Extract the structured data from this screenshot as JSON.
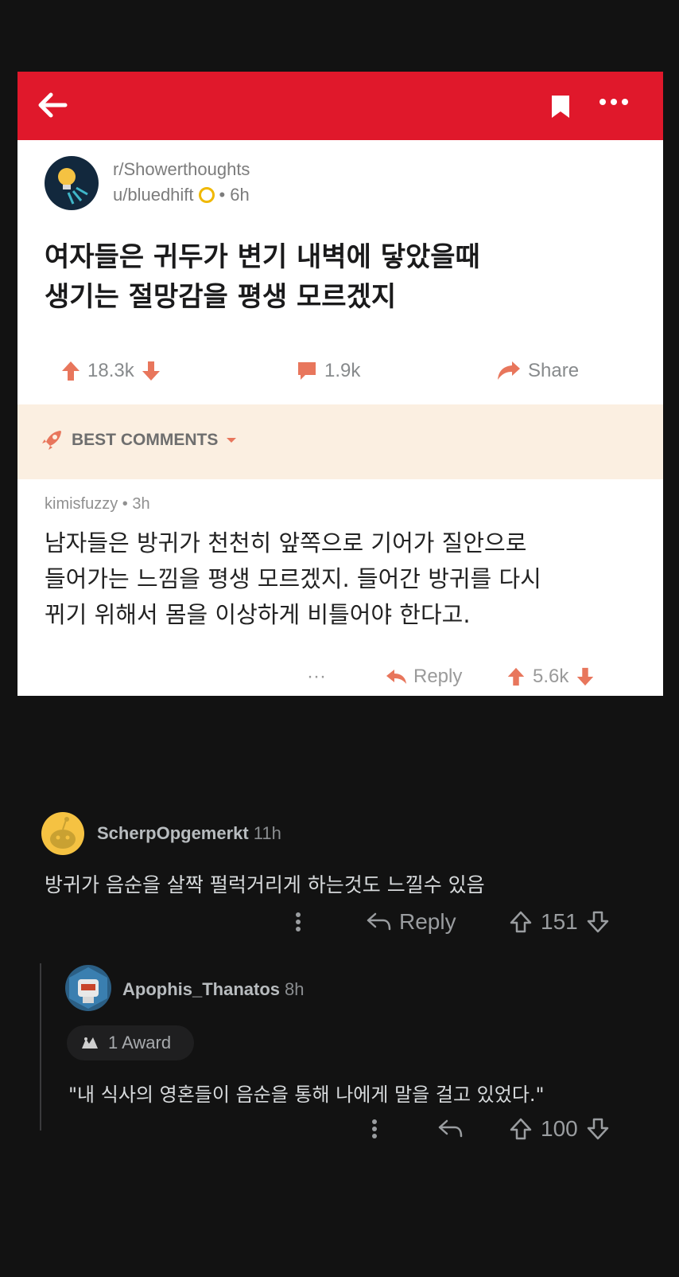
{
  "post": {
    "subreddit": "r/Showerthoughts",
    "author": "u/bluedhift",
    "time": "6h",
    "title_line1": "여자들은 귀두가 변기 내벽에 닿았을때",
    "title_line2": "생기는 절망감을 평생 모르겠지",
    "upvotes": "18.3k",
    "comments": "1.9k",
    "share_label": "Share",
    "best_comments_label": "BEST COMMENTS",
    "top_comment": {
      "author": "kimisfuzzy",
      "time": "3h",
      "line1": "남자들은 방귀가 천천히 앞쪽으로 기어가 질안으로",
      "line2": "들어가는 느낌을 평생 모르겠지. 들어간 방귀를 다시",
      "line3": "뀌기 위해서 몸을 이상하게 비틀어야 한다고.",
      "more": "···",
      "reply_label": "Reply",
      "votes": "5.6k"
    }
  },
  "comments": [
    {
      "author": "ScherpOpgemerkt",
      "time": "11h",
      "text": "방귀가 음순을 살짝 펄럭거리게 하는것도 느낄수 있음",
      "reply_label": "Reply",
      "votes": "151"
    },
    {
      "author": "Apophis_Thanatos",
      "time": "8h",
      "award_label": "1 Award",
      "text": "\"내 식사의 영혼들이 음순을 통해 나에게 말을 걸고 있었다.\"",
      "votes": "100"
    }
  ],
  "colors": {
    "reddit_red": "#e0182b",
    "upvote": "#e8765c",
    "background": "#121212"
  }
}
